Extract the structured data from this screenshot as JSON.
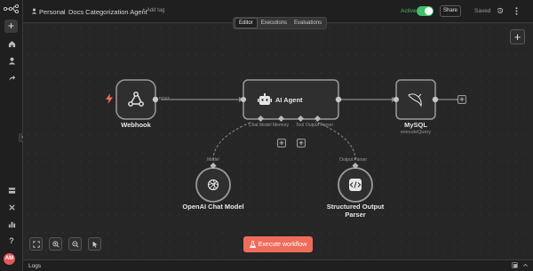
{
  "header": {
    "workspace": "Personal",
    "workflow_name": "Docs Categorization Agent",
    "add_tag": "+ Add tag",
    "active_label": "Active",
    "active": true,
    "share_label": "Share",
    "saved_label": "Saved"
  },
  "tabs": [
    {
      "label": "Editor",
      "active": true
    },
    {
      "label": "Executions",
      "active": false
    },
    {
      "label": "Evaluations",
      "active": false
    }
  ],
  "nodes": {
    "webhook": {
      "title": "Webhook",
      "icon": "webhook-icon",
      "trigger_icon": "lightning-icon",
      "output_label": "POST"
    },
    "agent": {
      "title": "AI Agent",
      "icon": "robot-icon",
      "ports": [
        "Chat Model",
        "Memory",
        "Tool",
        "Output Parser"
      ]
    },
    "mysql": {
      "title": "MySQL",
      "subtitle": "executeQuery",
      "icon": "dolphin-icon"
    },
    "openai": {
      "title": "OpenAI Chat Model",
      "icon": "openai-icon",
      "port_label": "Model"
    },
    "parser": {
      "title": "Structured Output Parser",
      "title_line1": "Structured Output",
      "title_line2": "Parser",
      "icon": "code-icon",
      "port_label": "Output Parser"
    }
  },
  "execute_label": "Execute workflow",
  "logs_label": "Logs",
  "colors": {
    "accent": "#ef6c5a",
    "active_green": "#3ec06a",
    "canvas": "#262626"
  }
}
